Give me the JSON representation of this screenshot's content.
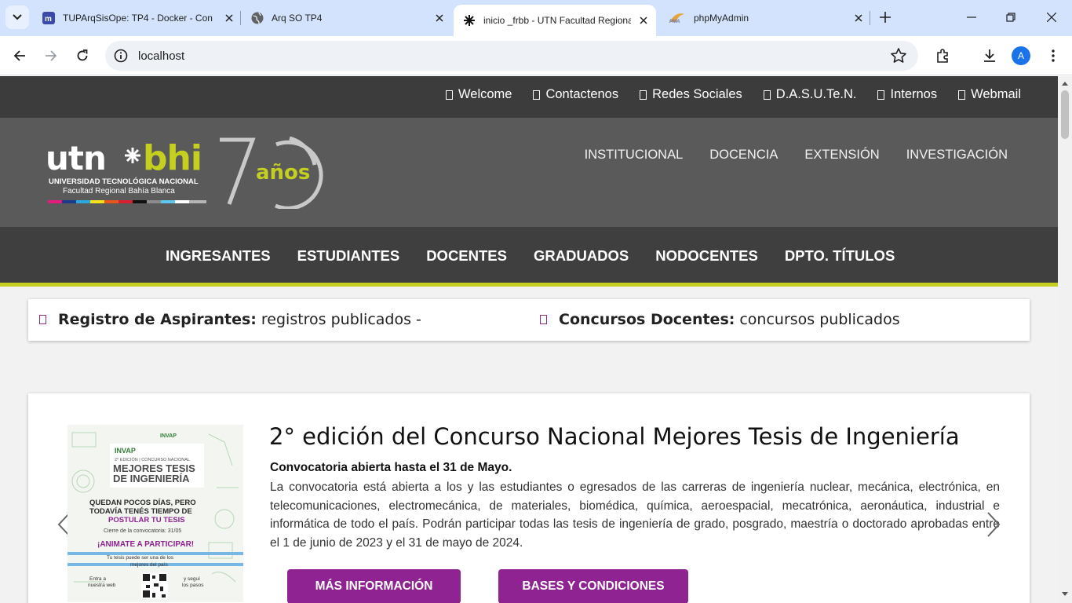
{
  "browser": {
    "tabs": [
      {
        "title": "TUPArqSisOpe: TP4 - Docker - Con",
        "icon": "moodle-icon",
        "active": false
      },
      {
        "title": "Arq SO TP4",
        "icon": "globe-icon",
        "active": false
      },
      {
        "title": "inicio _frbb - UTN Facultad Regional",
        "icon": "utn-icon",
        "active": true
      },
      {
        "title": "phpMyAdmin",
        "icon": "phpmyadmin-icon",
        "active": false
      }
    ],
    "url": "localhost",
    "profile_initial": "A"
  },
  "site": {
    "top_links": [
      "Welcome",
      "Contactenos",
      "Redes Sociales",
      "D.A.S.U.Te.N.",
      "Internos",
      "Webmail"
    ],
    "logo": {
      "brand": "utn bhi",
      "line1": "UNIVERSIDAD TECNOLÓGICA NACIONAL",
      "line2": "Facultad Regional Bahía Blanca",
      "anniversary": "años"
    },
    "main_nav": [
      "INSTITUCIONAL",
      "DOCENCIA",
      "EXTENSIÓN",
      "INVESTIGACIÓN"
    ],
    "sub_nav": [
      "INGRESANTES",
      "ESTUDIANTES",
      "DOCENTES",
      "GRADUADOS",
      "NODOCENTES",
      "DPTO. TÍTULOS"
    ],
    "ticker": [
      {
        "label": "Registro de Aspirantes:",
        "text": "registros publicados -"
      },
      {
        "label": "Concursos Docentes:",
        "text": "concursos publicados"
      }
    ],
    "slide": {
      "title": "2° edición del Concurso Nacional Mejores Tesis de Ingeniería",
      "subtitle": "Convocatoria abierta hasta el 31 de Mayo.",
      "description": "La convocatoria está abierta a los y las estudiantes o egresados de las carreras de ingeniería nuclear, mecánica, electrónica, en telecomunicaciones, electromecánica, de materiales, biomédica, química, aeroespacial, mecatrónica, aeronáutica, industrial e informática de todo el país. Podrán participar todas las tesis de ingeniería de grado, posgrado, maestría o doctorado aprobadas entre el 1 de junio de 2023 y el 31 de mayo de 2024.",
      "buttons": [
        "MÁS INFORMACIÓN",
        "BASES Y CONDICIONES"
      ],
      "poster": {
        "org": "INVAP",
        "edition": "2° EDICIÓN | CONCURSO NACIONAL",
        "headline1": "MEJORES TESIS",
        "headline2": "DE INGENIERÍA",
        "msg1": "QUEDAN POCOS DÍAS, PERO",
        "msg2": "TODAVÍA TENÉS TIEMPO DE",
        "msg3": "POSTULAR TU TESIS",
        "close": "Cierre de la convocatoria: 31/05",
        "cta": "¡ANIMATE A PARTICIPAR!",
        "tag1": "Tu tesis puede ser una de los",
        "tag2": "mejores del país",
        "left1": "Entra a",
        "left2": "nuestra web",
        "right1": "y seguí",
        "right2": "los pasos"
      }
    }
  },
  "colors": {
    "accent_purple": "#8e2391",
    "accent_lime": "#c5cf1f",
    "tabbar": "#d3e3fd"
  }
}
